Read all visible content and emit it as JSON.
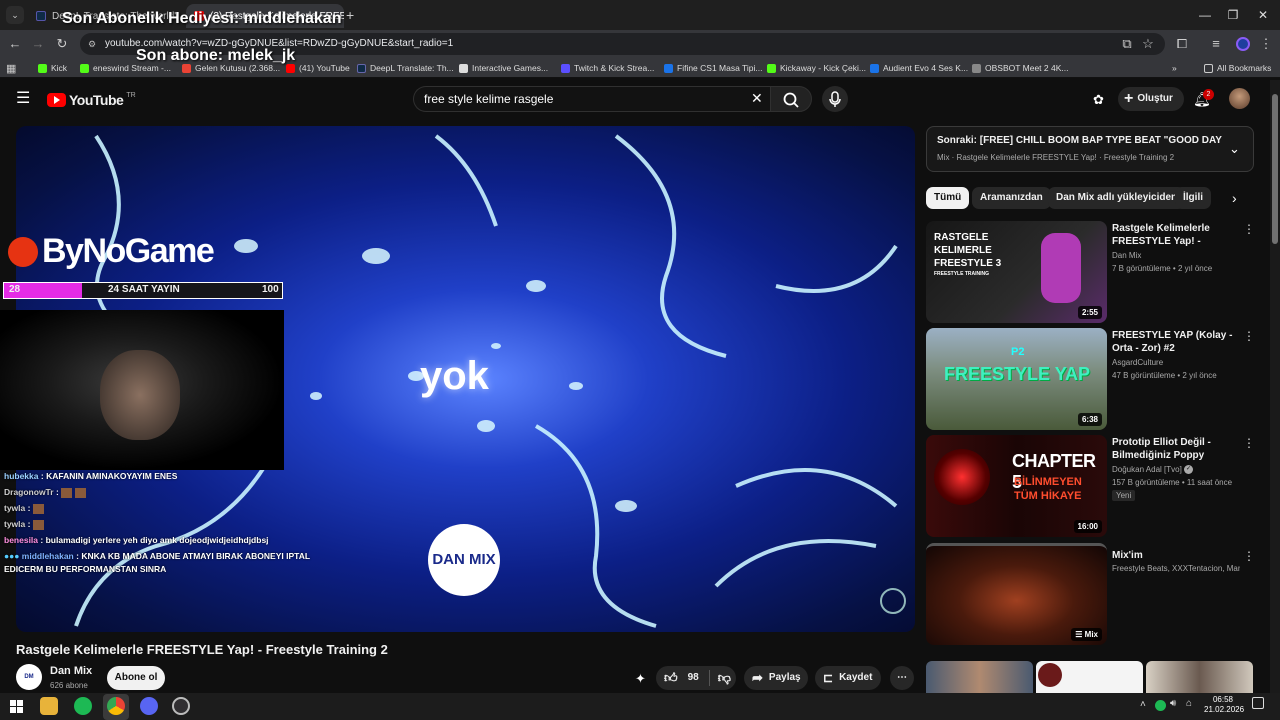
{
  "browser": {
    "tabs": [
      {
        "label": "DeepL Translate: The world's"
      },
      {
        "label": "(2) Rastgele Kelimelerle FREEST"
      }
    ],
    "url": "youtube.com/watch?v=wZD-gGyDNUE&list=RDwZD-gGyDNUE&start_radio=1",
    "bookmarks": [
      "Kick",
      "eneswind Stream -...",
      "Gelen Kutusu (2.368...",
      "(41) YouTube",
      "DeepL Translate: Th...",
      "Interactive Games...",
      "Twitch & Kick Strea...",
      "Fifine CS1 Masa Tipi...",
      "Kickaway - Kick Çeki...",
      "Audient Evo 4 Ses K...",
      "OBSBOT Meet 2 4K..."
    ],
    "all_bookmarks": "All Bookmarks",
    "bookmark_more": "»"
  },
  "stream_overlay": {
    "last_gift": "Son Abonelik Hediyesi: middlehakan",
    "last_sub": "Son abone: melek_jk",
    "brand": "ByNoGame",
    "bar_left": "28",
    "bar_center": "24 SAAT YAYIN",
    "bar_right": "100",
    "bar_fill": 0.28,
    "chat": [
      {
        "user": "hubekka",
        "msg": "KAFANIN AMINAKOYAYIM ENES",
        "color": "#9ad0ff"
      },
      {
        "user": "DragonowTr",
        "msg": "",
        "color": "#cfcfcf"
      },
      {
        "user": "tywla",
        "msg": "",
        "color": "#cfcfcf"
      },
      {
        "user": "tywla",
        "msg": "",
        "color": "#cfcfcf"
      },
      {
        "user": "benesila",
        "msg": "bulamadigi yerlere yeh diyo amk dojeodjwidjeidhdjdbsj",
        "color": "#ff8fe0"
      },
      {
        "user": "middlehakan",
        "msg": "KNKA KB MADA ABONE ATMAYI BIRAK ABONEYI IPTAL",
        "color": "#7fb2ff"
      }
    ],
    "chat_cont": "EDICERM BU PERFORMANSTAN SINRA"
  },
  "youtube": {
    "logo": "YouTube",
    "region": "TR",
    "search_value": "free style kelime rasgele",
    "create_label": "Oluştur",
    "notif_count": "2",
    "video_word": "yok",
    "video_logo": "DAN MIX",
    "video_title": "Rastgele Kelimelerle FREESTYLE Yap! - Freestyle Training 2",
    "channel": "Dan Mix",
    "subs": "626 abone",
    "subscribe": "Abone ol",
    "likes": "98",
    "share": "Paylaş",
    "save": "Kaydet",
    "next_label": "Sonraki: [FREE] CHILL BOOM BAP TYPE BEAT \"GOOD DAY\" | JAZZ ...",
    "next_sub": "Mix · Rastgele Kelimelerle FREESTYLE Yap! · Freestyle Training 2",
    "chips": [
      "Tümü",
      "Aramanızdan",
      "Dan Mix adlı yükleyiciden",
      "İlgili"
    ],
    "related": [
      {
        "title": "Rastgele Kelimelerle FREESTYLE Yap! - Freestyle ...",
        "channel": "Dan Mix",
        "meta": "7 B görüntüleme • 2 yıl önce",
        "duration": "2:55",
        "thumb_text": "RASTGELE KELIMERLE FREESTYLE 3",
        "thumb_sub": "FREESTYLE TRAINING",
        "badge": ""
      },
      {
        "title": "FREESTYLE YAP (Kolay - Orta - Zor) #2",
        "channel": "AsgardCulture",
        "meta": "47 B görüntüleme • 2 yıl önce",
        "duration": "6:38",
        "thumb_text": "FREESTYLE YAP",
        "thumb_sub": "P2",
        "badge": ""
      },
      {
        "title": "Prototip Elliot Değil - Bilmediğiniz Poppy Playtime...",
        "channel": "Doğukan Adal [Tvo]",
        "meta": "157 B görüntüleme • 11 saat önce",
        "duration": "16:00",
        "thumb_text": "CHAPTER 5",
        "thumb_sub": "BİLİNMEYEN TÜM HİKAYE",
        "badge": "Yeni"
      },
      {
        "title": "Mix'im",
        "channel": "Freestyle Beats, XXXTentacion, Manife...",
        "meta": "",
        "duration": "Mix",
        "thumb_text": "",
        "thumb_sub": "",
        "badge": ""
      }
    ]
  },
  "taskbar": {
    "time": "06:58",
    "date": "21.02.2026"
  },
  "colors": {
    "accent_red": "#ff0000",
    "progress_pink": "#e52be6"
  }
}
